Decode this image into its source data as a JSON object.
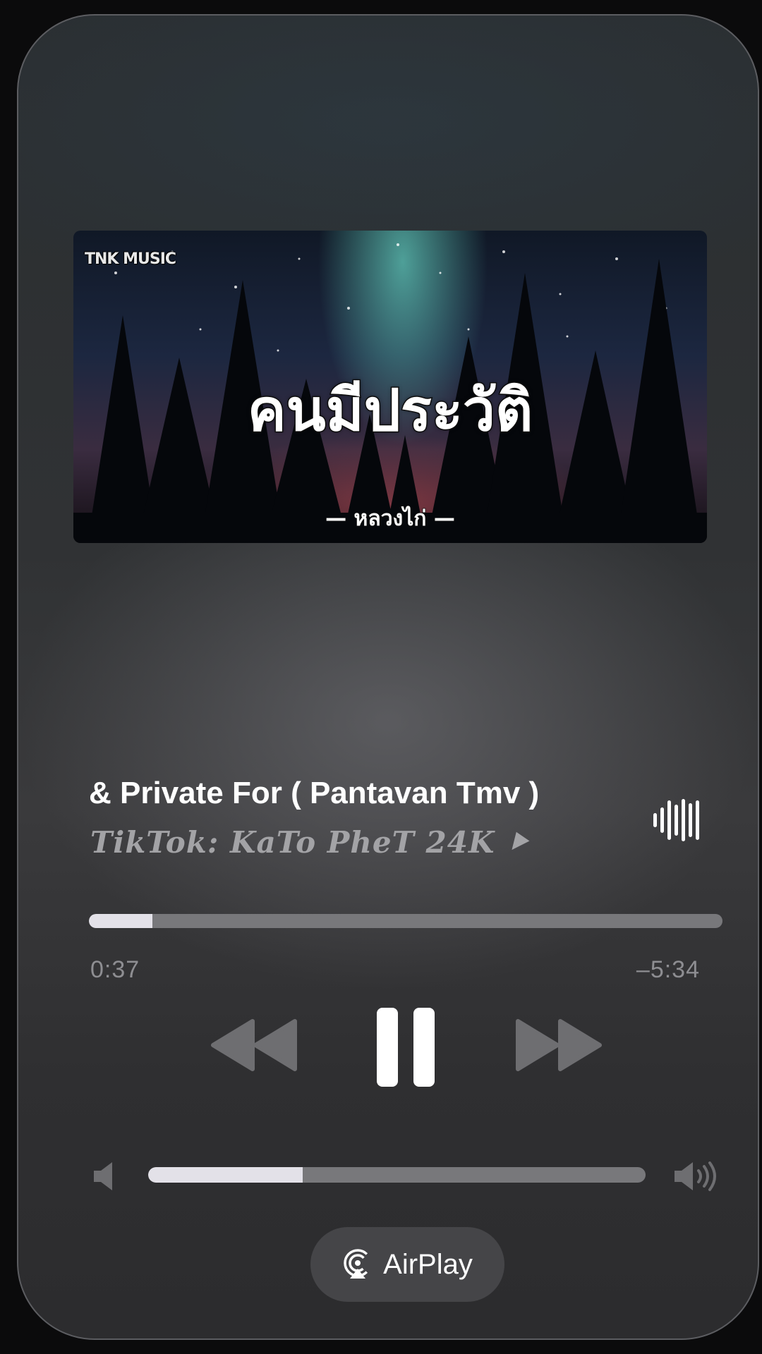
{
  "artwork": {
    "label": "TNK MUSIC",
    "title": "คนมีประวัติ",
    "subtitle": "— หลวงไก่ —"
  },
  "now_playing": {
    "title": "& Private For ( Pantavan Tmv )",
    "artist": "TikTok: KaTo PheT 24K ⯈",
    "elapsed": "0:37",
    "remaining": "–5:34",
    "progress": 0.1
  },
  "controls": {
    "rewind_icon": "rewind-icon",
    "pause_icon": "pause-icon",
    "forward_icon": "fast-forward-icon",
    "waveform_icon": "waveform-icon"
  },
  "volume": {
    "level": 0.31,
    "low_icon": "speaker-low-icon",
    "high_icon": "speaker-high-icon"
  },
  "airplay": {
    "label": "AirPlay",
    "icon": "airplay-icon"
  },
  "colors": {
    "track": "#78787b",
    "fill": "#e3e1e8",
    "muted_text": "#8e8e92",
    "button_bg": "#454548"
  }
}
